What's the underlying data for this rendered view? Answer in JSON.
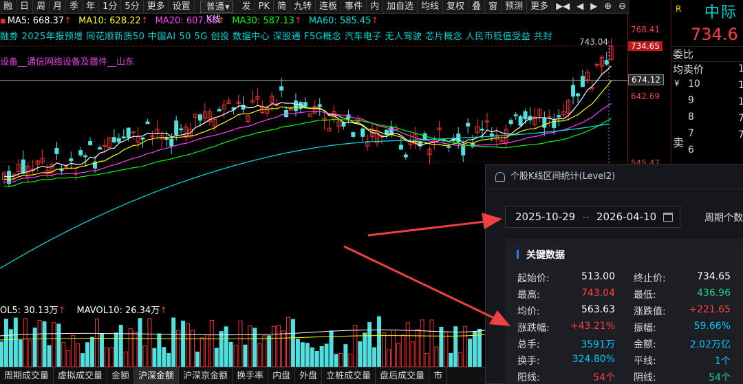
{
  "toolbar": {
    "items_left": [
      "融",
      "日",
      "周",
      "月",
      "季",
      "年",
      "1分",
      "5分",
      "更多",
      "设置"
    ],
    "dropdown": "普通K线",
    "items_right": [
      "发",
      "PK",
      "简",
      "九转",
      "连板",
      "事件",
      "内",
      "加自选",
      "均线",
      "复权",
      "叠",
      "窗",
      "预测",
      "更多"
    ]
  },
  "ma_line": [
    {
      "label": "MA5: 668.37",
      "color": "#ffffff"
    },
    {
      "label": "MA10: 628.22",
      "color": "#ffff00"
    },
    {
      "label": "MA20: 607.08",
      "color": "#ff40ff"
    },
    {
      "label": "MA30: 587.13",
      "color": "#00ff00"
    },
    {
      "label": "MA60: 585.45",
      "color": "#00e0e0"
    }
  ],
  "concept_line": "融劵  2025年报预增  同花顺新质50  中国AI 50  5G  创投  数据中心  深股通  F5G概念  汽车电子  无人驾驶  芯片概念  人民币贬值受益  共封",
  "industry_line": "设备__通信网络设备及器件__山东",
  "high_marker": "743.04",
  "price_axis": {
    "top": "768.41",
    "current": "734.65",
    "line": "674.12",
    "mid": "642.69",
    "lower": "545.47"
  },
  "right_panel": {
    "flag": "R",
    "name": "中际",
    "price": "734.6",
    "row1": "委比",
    "row2": "均卖价",
    "ask_levels": [
      "10",
      "9",
      "8",
      "7",
      "6"
    ],
    "ask_prefix": "¥",
    "sell_label": "卖",
    "right_digits": [
      "1",
      "1",
      "1",
      "7",
      "7"
    ]
  },
  "volume": {
    "legend1": "OL5: 30.13万",
    "legend2": "MAVOL10: 26.34万"
  },
  "bottom_tabs": [
    "周期成交量",
    "虚拟成交量",
    "金额",
    "沪深金额",
    "沪深京金额",
    "换手率",
    "内盘",
    "外盘",
    "立桩成交量",
    "盘后成交量",
    "市"
  ],
  "dialog": {
    "title": "个股K线区间统计(Level2)",
    "date_start": "2025-10-29",
    "date_sep": "--",
    "date_end": "2026-04-10",
    "period_label": "周期个数",
    "section_title": "关键数据",
    "stats": [
      {
        "label": "起始价:",
        "value": "513.00",
        "color": "#ffffff"
      },
      {
        "label": "终止价:",
        "value": "734.65",
        "color": "#ffffff"
      },
      {
        "label": "最高:",
        "value": "743.04",
        "color": "#ff4040"
      },
      {
        "label": "最低:",
        "value": "436.96",
        "color": "#20d080"
      },
      {
        "label": "均价:",
        "value": "563.63",
        "color": "#ffffff"
      },
      {
        "label": "涨跌值:",
        "value": "+221.65",
        "color": "#ff4040"
      },
      {
        "label": "涨跌幅:",
        "value": "+43.21%",
        "color": "#ff4040"
      },
      {
        "label": "振幅:",
        "value": "59.66%",
        "color": "#00c8ff"
      },
      {
        "label": "总手:",
        "value": "3591万",
        "color": "#00c8ff"
      },
      {
        "label": "金额:",
        "value": "2.02万亿",
        "color": "#00c8ff"
      },
      {
        "label": "换手:",
        "value": "324.80%",
        "color": "#00c8ff"
      },
      {
        "label": "平线:",
        "value": "1个",
        "color": "#00c8ff"
      },
      {
        "label": "阳线:",
        "value": "54个",
        "color": "#ff4040"
      },
      {
        "label": "阴线:",
        "value": "54个",
        "color": "#20d080"
      }
    ]
  },
  "colors": {
    "up": "#ff3030",
    "down": "#50e0e0",
    "ma5": "#ffffff",
    "ma10": "#ffff00",
    "ma20": "#ff40ff",
    "ma30": "#00ff00",
    "ma60": "#00e0e0",
    "arrow": "#f04040"
  }
}
